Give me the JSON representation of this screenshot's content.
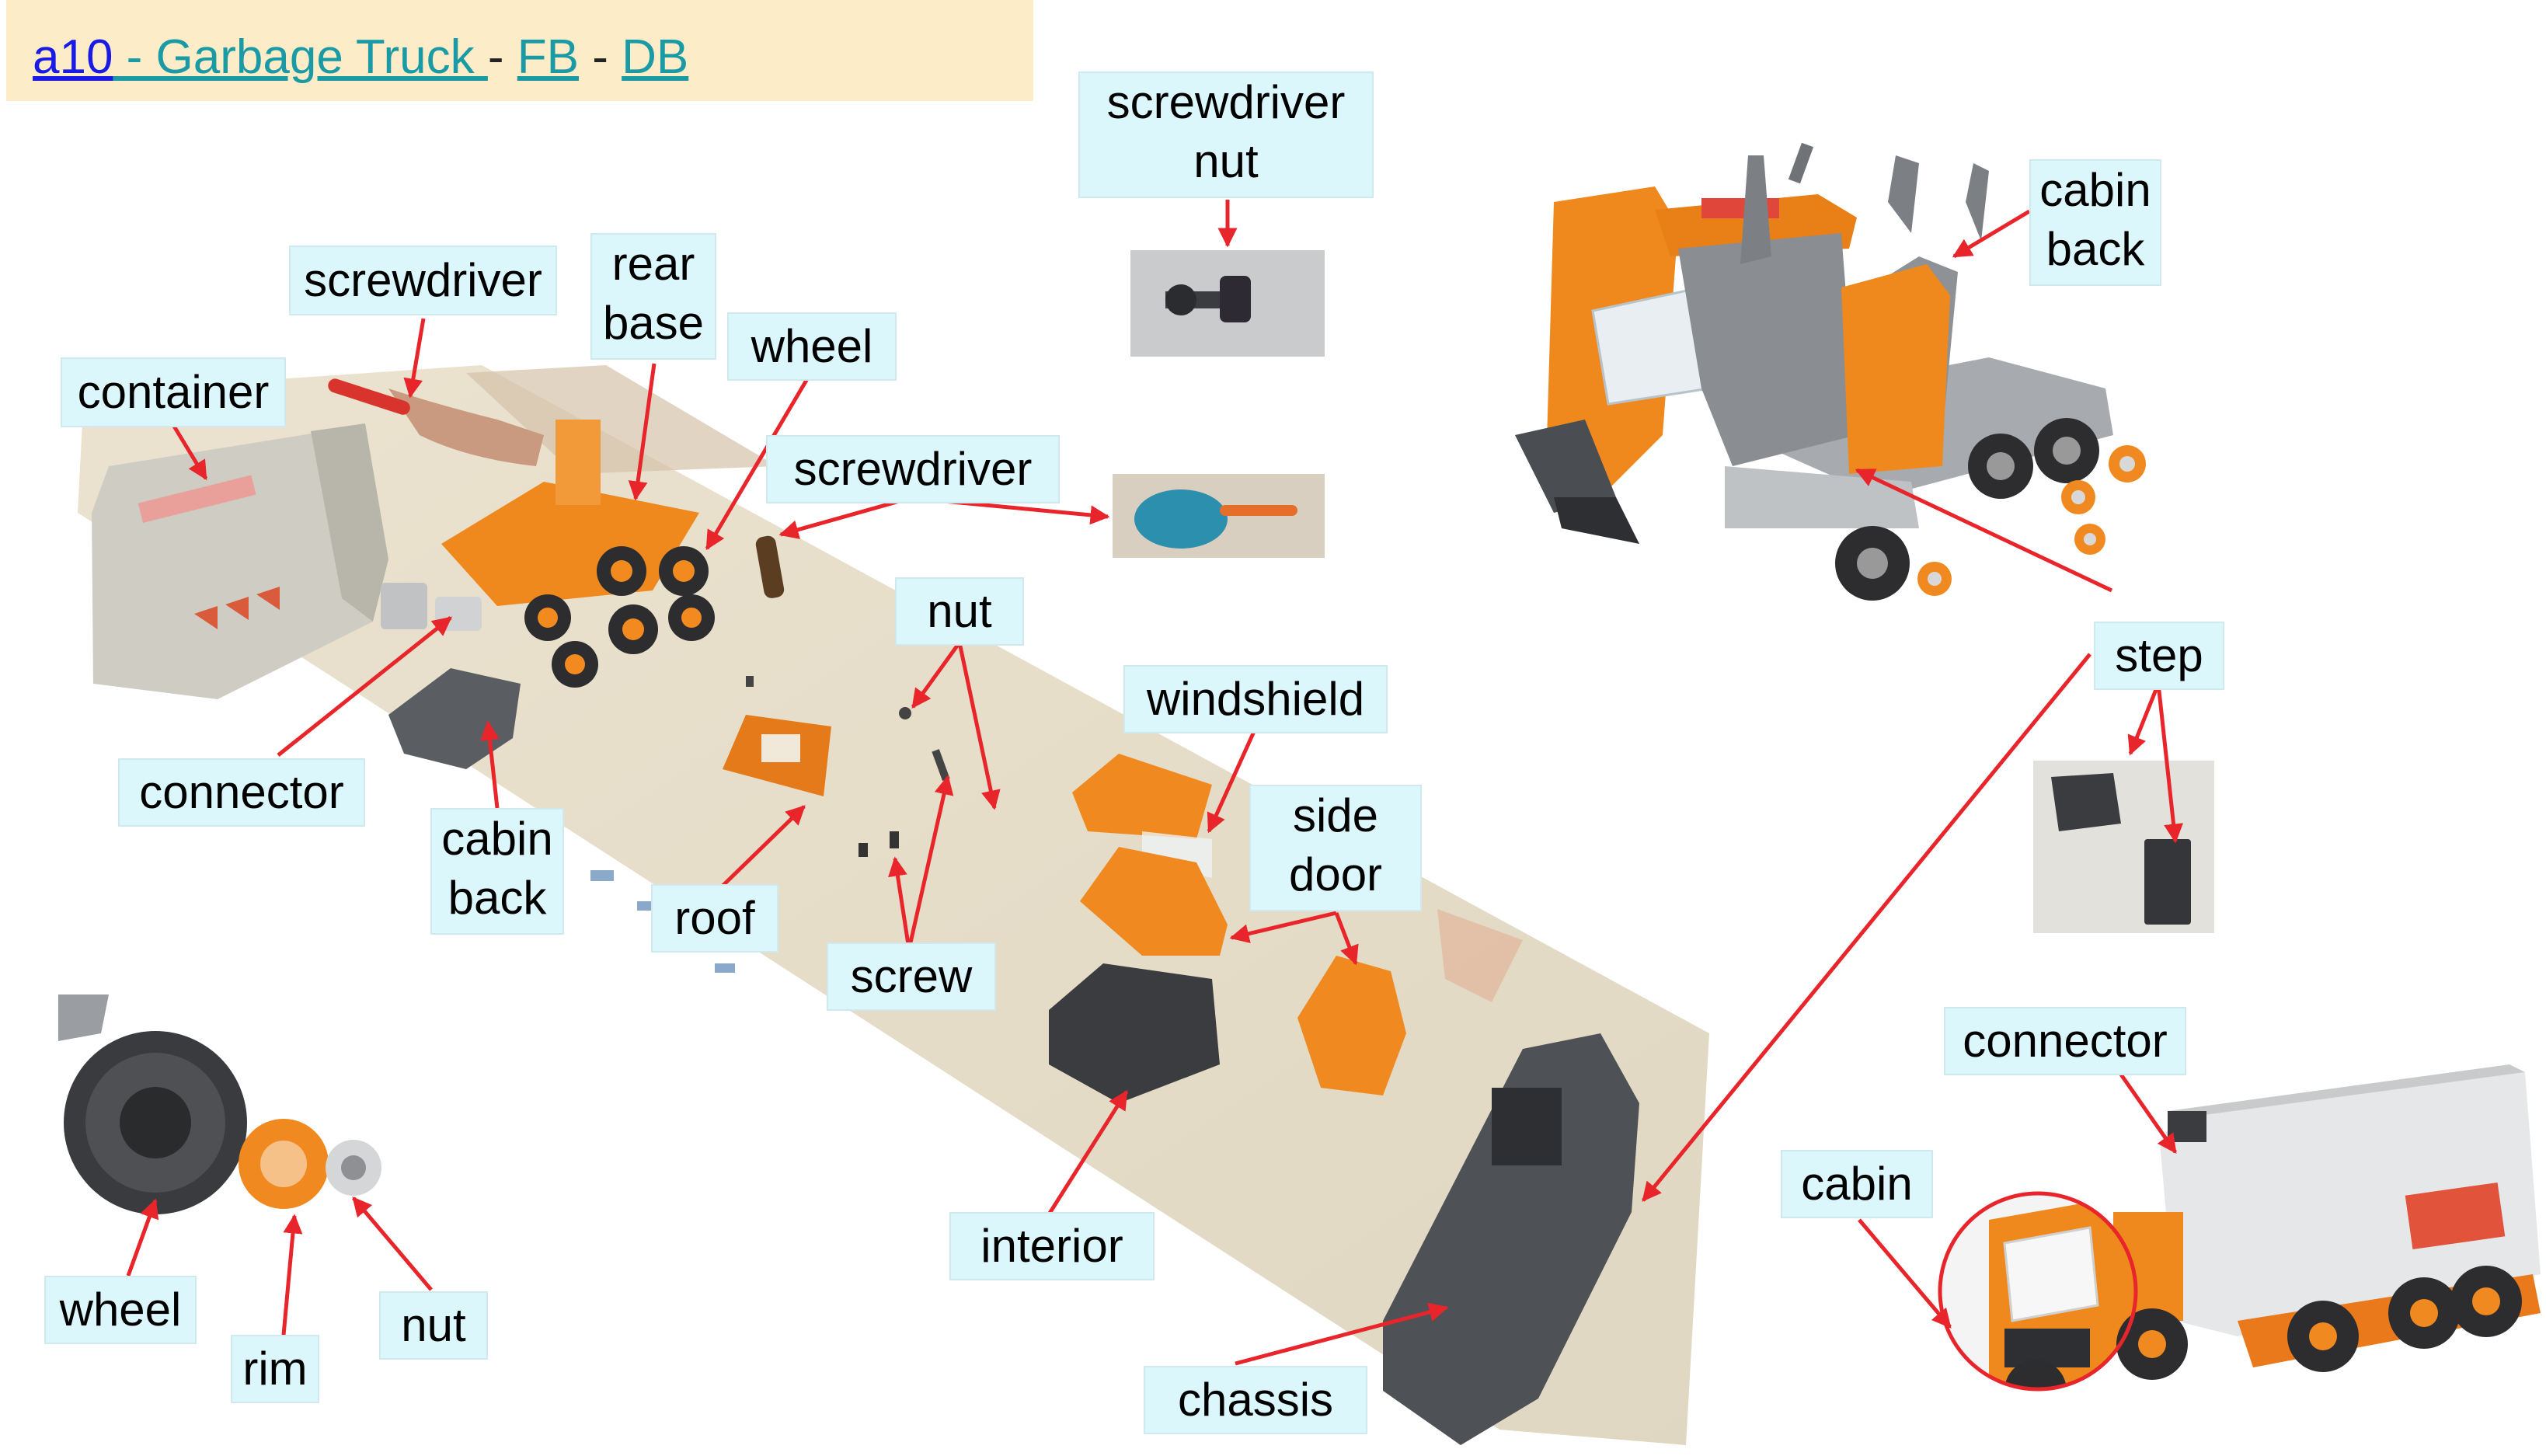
{
  "header": {
    "id_link": "a10",
    "name_link": " - Garbage Truck ",
    "sep1": " - ",
    "fb_link": "FB",
    "sep2": " - ",
    "db_link": "DB"
  },
  "labels": {
    "screwdriver_nut": [
      "screwdriver",
      "nut"
    ],
    "cabin_back_top": [
      "cabin",
      "back"
    ],
    "screwdriver_top": "screwdriver",
    "rear_base": [
      "rear",
      "base"
    ],
    "wheel_top": "wheel",
    "container": "container",
    "screwdriver_mid": "screwdriver",
    "nut_mid": "nut",
    "step": "step",
    "windshield": "windshield",
    "connector_left": "connector",
    "cabin_back_mid": [
      "cabin",
      "back"
    ],
    "side_door": [
      "side",
      "door"
    ],
    "roof": "roof",
    "screw": "screw",
    "connector_right": "connector",
    "cabin": "cabin",
    "interior": "interior",
    "wheel_bottom": "wheel",
    "rim": "rim",
    "nut_bottom": "nut",
    "chassis": "chassis"
  },
  "colors": {
    "label_bg": "#dcf7fb",
    "arrow": "#e8252b",
    "header_bg": "#fcecc8",
    "truck_orange": "#f0891d",
    "plastic_gray": "#8e9296",
    "dark_gray": "#3a3c40"
  }
}
